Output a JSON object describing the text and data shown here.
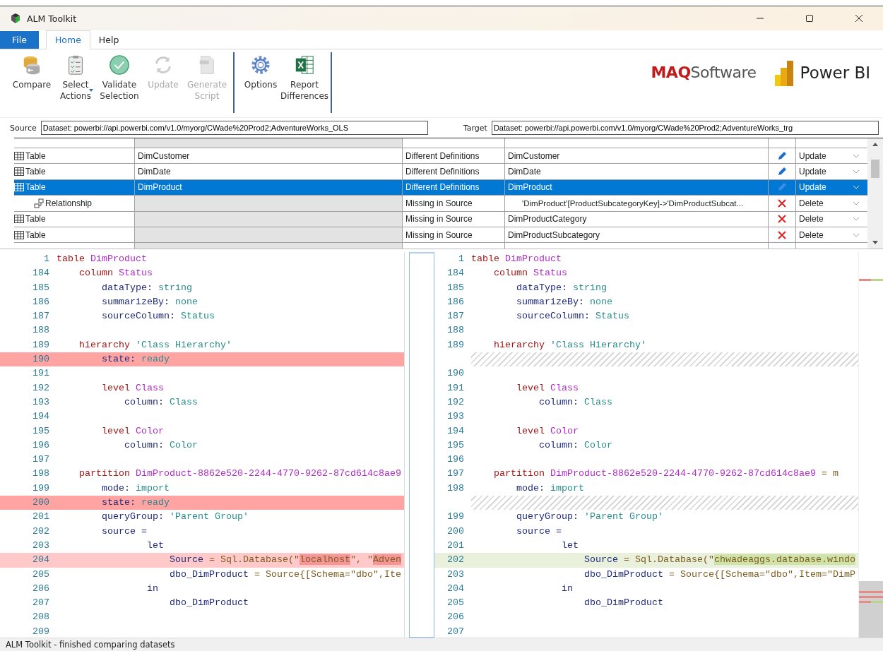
{
  "window": {
    "title": "ALM Toolkit"
  },
  "ribbon_tabs": [
    {
      "label": "File",
      "kind": "file",
      "selected": false
    },
    {
      "label": "Home",
      "kind": "tab",
      "selected": true
    },
    {
      "label": "Help",
      "kind": "tab",
      "selected": false
    }
  ],
  "ribbon_groups": [
    [
      {
        "label": "Compare",
        "kind": "compare",
        "disabled": false,
        "dropdown": false
      },
      {
        "label": "Select Actions",
        "kind": "select",
        "disabled": false,
        "dropdown": true
      },
      {
        "label": "Validate Selection",
        "kind": "validate",
        "disabled": false,
        "dropdown": false
      },
      {
        "label": "Update",
        "kind": "update",
        "disabled": true,
        "dropdown": false
      },
      {
        "label": "Generate Script",
        "kind": "script",
        "disabled": true,
        "dropdown": false
      }
    ],
    [
      {
        "label": "Options",
        "kind": "options",
        "disabled": false,
        "dropdown": false
      },
      {
        "label": "Report Differences",
        "kind": "report",
        "disabled": false,
        "dropdown": false
      }
    ]
  ],
  "brand": {
    "maq_strong": "MAQ",
    "maq_rest": "Software",
    "product": "Power BI"
  },
  "source": {
    "label": "Source",
    "value": "Dataset: powerbi://api.powerbi.com/v1.0/myorg/CWade%20Prod2;AdventureWorks_OLS"
  },
  "target": {
    "label": "Target",
    "value": "Dataset: powerbi://api.powerbi.com/v1.0/myorg/CWade%20Prod2;AdventureWorks_trg"
  },
  "grid": {
    "rows": [
      {
        "type": "Table",
        "kind": "table",
        "source": "DimCustomer",
        "status": "Different Definitions",
        "target": "DimCustomer",
        "action": {
          "label": "Update",
          "kind": "update"
        },
        "selected": false
      },
      {
        "type": "Table",
        "kind": "table",
        "source": "DimDate",
        "status": "Different Definitions",
        "target": "DimDate",
        "action": {
          "label": "Update",
          "kind": "update"
        },
        "selected": false
      },
      {
        "type": "Table",
        "kind": "table",
        "source": "DimProduct",
        "status": "Different Definitions",
        "target": "DimProduct",
        "action": {
          "label": "Update",
          "kind": "update"
        },
        "selected": true,
        "children": [
          {
            "type": "Relationship",
            "kind": "relationship",
            "status": "Missing in Source",
            "target": "'DimProduct'[ProductSubcategoryKey]->'DimProductSubcat...",
            "action": {
              "label": "Delete",
              "kind": "delete"
            },
            "selected": false
          }
        ]
      },
      {
        "type": "Table",
        "kind": "table",
        "status": "Missing in Source",
        "target": "DimProductCategory",
        "action": {
          "label": "Delete",
          "kind": "delete"
        },
        "selected": false
      },
      {
        "type": "Table",
        "kind": "table",
        "status": "Missing in Source",
        "target": "DimProductSubcategory",
        "action": {
          "label": "Delete",
          "kind": "delete"
        },
        "selected": false
      }
    ]
  },
  "source_code": [
    {
      "num": "1",
      "kind": "same",
      "tokens": [
        {
          "text": "table ",
          "kind": "keyword"
        },
        {
          "text": "DimProduct",
          "kind": "name"
        }
      ]
    },
    {
      "num": "184",
      "kind": "same",
      "tokens": [
        {
          "text": "    column ",
          "kind": "keyword"
        },
        {
          "text": "Status",
          "kind": "name"
        }
      ]
    },
    {
      "num": "185",
      "kind": "same",
      "tokens": [
        {
          "text": "        dataType: ",
          "kind": "property"
        },
        {
          "text": "string",
          "kind": "value"
        }
      ]
    },
    {
      "num": "186",
      "kind": "same",
      "tokens": [
        {
          "text": "        summarizeBy: ",
          "kind": "property"
        },
        {
          "text": "none",
          "kind": "value"
        }
      ]
    },
    {
      "num": "187",
      "kind": "same",
      "tokens": [
        {
          "text": "        sourceColumn: ",
          "kind": "property"
        },
        {
          "text": "Status",
          "kind": "value"
        }
      ]
    },
    {
      "num": "188",
      "kind": "same"
    },
    {
      "num": "189",
      "kind": "same",
      "tokens": [
        {
          "text": "    hierarchy ",
          "kind": "keyword"
        },
        {
          "text": "'Class Hierarchy'",
          "kind": "value"
        }
      ]
    },
    {
      "num": "190",
      "kind": "deleted",
      "tokens": [
        {
          "text": "        state: ",
          "kind": "property"
        },
        {
          "text": "ready",
          "kind": "value"
        }
      ]
    },
    {
      "num": "191",
      "kind": "same"
    },
    {
      "num": "192",
      "kind": "same",
      "tokens": [
        {
          "text": "        level ",
          "kind": "keyword"
        },
        {
          "text": "Class",
          "kind": "name"
        }
      ]
    },
    {
      "num": "193",
      "kind": "same",
      "tokens": [
        {
          "text": "            column: ",
          "kind": "property"
        },
        {
          "text": "Class",
          "kind": "value"
        }
      ]
    },
    {
      "num": "194",
      "kind": "same"
    },
    {
      "num": "195",
      "kind": "same",
      "tokens": [
        {
          "text": "        level ",
          "kind": "keyword"
        },
        {
          "text": "Color",
          "kind": "name"
        }
      ]
    },
    {
      "num": "196",
      "kind": "same",
      "tokens": [
        {
          "text": "            column: ",
          "kind": "property"
        },
        {
          "text": "Color",
          "kind": "value"
        }
      ]
    },
    {
      "num": "197",
      "kind": "same"
    },
    {
      "num": "198",
      "kind": "same",
      "tokens": [
        {
          "text": "    partition ",
          "kind": "keyword"
        },
        {
          "text": "DimProduct-8862e520-2244-4770-9262-87cd614c8ae9",
          "kind": "name"
        }
      ]
    },
    {
      "num": "199",
      "kind": "same",
      "tokens": [
        {
          "text": "        mode: ",
          "kind": "property"
        },
        {
          "text": "import",
          "kind": "value"
        }
      ]
    },
    {
      "num": "200",
      "kind": "deleted",
      "tokens": [
        {
          "text": "        state: ",
          "kind": "property"
        },
        {
          "text": "ready",
          "kind": "value"
        }
      ]
    },
    {
      "num": "201",
      "kind": "same",
      "tokens": [
        {
          "text": "        queryGroup: ",
          "kind": "property"
        },
        {
          "text": "'Parent Group'",
          "kind": "value"
        }
      ]
    },
    {
      "num": "202",
      "kind": "same",
      "tokens": [
        {
          "text": "        source =",
          "kind": "property"
        }
      ]
    },
    {
      "num": "203",
      "kind": "same",
      "tokens": [
        {
          "text": "                let",
          "kind": "property"
        }
      ]
    },
    {
      "num": "204",
      "kind": "modified",
      "tokens": [
        {
          "text": "                    Source",
          "kind": "property"
        },
        {
          "text": " = Sql.Database(\"",
          "kind": "expr"
        },
        {
          "text": "localhost",
          "kind": "highlight"
        },
        {
          "text": "\", \"",
          "kind": "expr"
        },
        {
          "text": "Adven",
          "kind": "highlight"
        }
      ]
    },
    {
      "num": "205",
      "kind": "same",
      "tokens": [
        {
          "text": "                    dbo_DimProduct",
          "kind": "property"
        },
        {
          "text": " = Source{[Schema=\"dbo\",Ite",
          "kind": "expr"
        }
      ]
    },
    {
      "num": "206",
      "kind": "same",
      "tokens": [
        {
          "text": "                in",
          "kind": "property"
        }
      ]
    },
    {
      "num": "207",
      "kind": "same",
      "tokens": [
        {
          "text": "                    dbo_DimProduct",
          "kind": "property"
        }
      ]
    },
    {
      "num": "208",
      "kind": "same"
    },
    {
      "num": "209",
      "kind": "same"
    }
  ],
  "target_code": [
    {
      "num": "1",
      "kind": "same",
      "tokens": [
        {
          "text": "table ",
          "kind": "keyword"
        },
        {
          "text": "DimProduct",
          "kind": "name"
        }
      ]
    },
    {
      "num": "184",
      "kind": "same",
      "tokens": [
        {
          "text": "    column ",
          "kind": "keyword"
        },
        {
          "text": "Status",
          "kind": "name"
        }
      ]
    },
    {
      "num": "185",
      "kind": "same",
      "tokens": [
        {
          "text": "        dataType: ",
          "kind": "property"
        },
        {
          "text": "string",
          "kind": "value"
        }
      ]
    },
    {
      "num": "186",
      "kind": "same",
      "tokens": [
        {
          "text": "        summarizeBy: ",
          "kind": "property"
        },
        {
          "text": "none",
          "kind": "value"
        }
      ]
    },
    {
      "num": "187",
      "kind": "same",
      "tokens": [
        {
          "text": "        sourceColumn: ",
          "kind": "property"
        },
        {
          "text": "Status",
          "kind": "value"
        }
      ]
    },
    {
      "num": "188",
      "kind": "same"
    },
    {
      "num": "189",
      "kind": "same",
      "tokens": [
        {
          "text": "    hierarchy ",
          "kind": "keyword"
        },
        {
          "text": "'Class Hierarchy'",
          "kind": "value"
        }
      ]
    },
    {
      "kind": "filler"
    },
    {
      "num": "190",
      "kind": "same"
    },
    {
      "num": "191",
      "kind": "same",
      "tokens": [
        {
          "text": "        level ",
          "kind": "keyword"
        },
        {
          "text": "Class",
          "kind": "name"
        }
      ]
    },
    {
      "num": "192",
      "kind": "same",
      "tokens": [
        {
          "text": "            column: ",
          "kind": "property"
        },
        {
          "text": "Class",
          "kind": "value"
        }
      ]
    },
    {
      "num": "193",
      "kind": "same"
    },
    {
      "num": "194",
      "kind": "same",
      "tokens": [
        {
          "text": "        level ",
          "kind": "keyword"
        },
        {
          "text": "Color",
          "kind": "name"
        }
      ]
    },
    {
      "num": "195",
      "kind": "same",
      "tokens": [
        {
          "text": "            column: ",
          "kind": "property"
        },
        {
          "text": "Color",
          "kind": "value"
        }
      ]
    },
    {
      "num": "196",
      "kind": "same"
    },
    {
      "num": "197",
      "kind": "same",
      "tokens": [
        {
          "text": "    partition ",
          "kind": "keyword"
        },
        {
          "text": "DimProduct-8862e520-2244-4770-9262-87cd614c8ae9",
          "kind": "name"
        },
        {
          "text": " = m",
          "kind": "expr"
        }
      ]
    },
    {
      "num": "198",
      "kind": "same",
      "tokens": [
        {
          "text": "        mode: ",
          "kind": "property"
        },
        {
          "text": "import",
          "kind": "value"
        }
      ]
    },
    {
      "kind": "filler"
    },
    {
      "num": "199",
      "kind": "same",
      "tokens": [
        {
          "text": "        queryGroup: ",
          "kind": "property"
        },
        {
          "text": "'Parent Group'",
          "kind": "value"
        }
      ]
    },
    {
      "num": "200",
      "kind": "same",
      "tokens": [
        {
          "text": "        source =",
          "kind": "property"
        }
      ]
    },
    {
      "num": "201",
      "kind": "same",
      "tokens": [
        {
          "text": "                let",
          "kind": "property"
        }
      ]
    },
    {
      "num": "202",
      "kind": "added",
      "tokens": [
        {
          "text": "                    Source",
          "kind": "property"
        },
        {
          "text": " = Sql.Database(\"",
          "kind": "expr"
        },
        {
          "text": "chwadeaggs.database.windo",
          "kind": "highlight"
        }
      ]
    },
    {
      "num": "203",
      "kind": "same",
      "tokens": [
        {
          "text": "                    dbo_DimProduct",
          "kind": "property"
        },
        {
          "text": " = Source{[Schema=\"dbo\",Item=\"DimP",
          "kind": "expr"
        }
      ]
    },
    {
      "num": "204",
      "kind": "same",
      "tokens": [
        {
          "text": "                in",
          "kind": "property"
        }
      ]
    },
    {
      "num": "205",
      "kind": "same",
      "tokens": [
        {
          "text": "                    dbo_DimProduct",
          "kind": "property"
        }
      ]
    },
    {
      "num": "206",
      "kind": "same"
    },
    {
      "num": "207",
      "kind": "same"
    }
  ],
  "status_bar": "ALM Toolkit - finished comparing datasets"
}
